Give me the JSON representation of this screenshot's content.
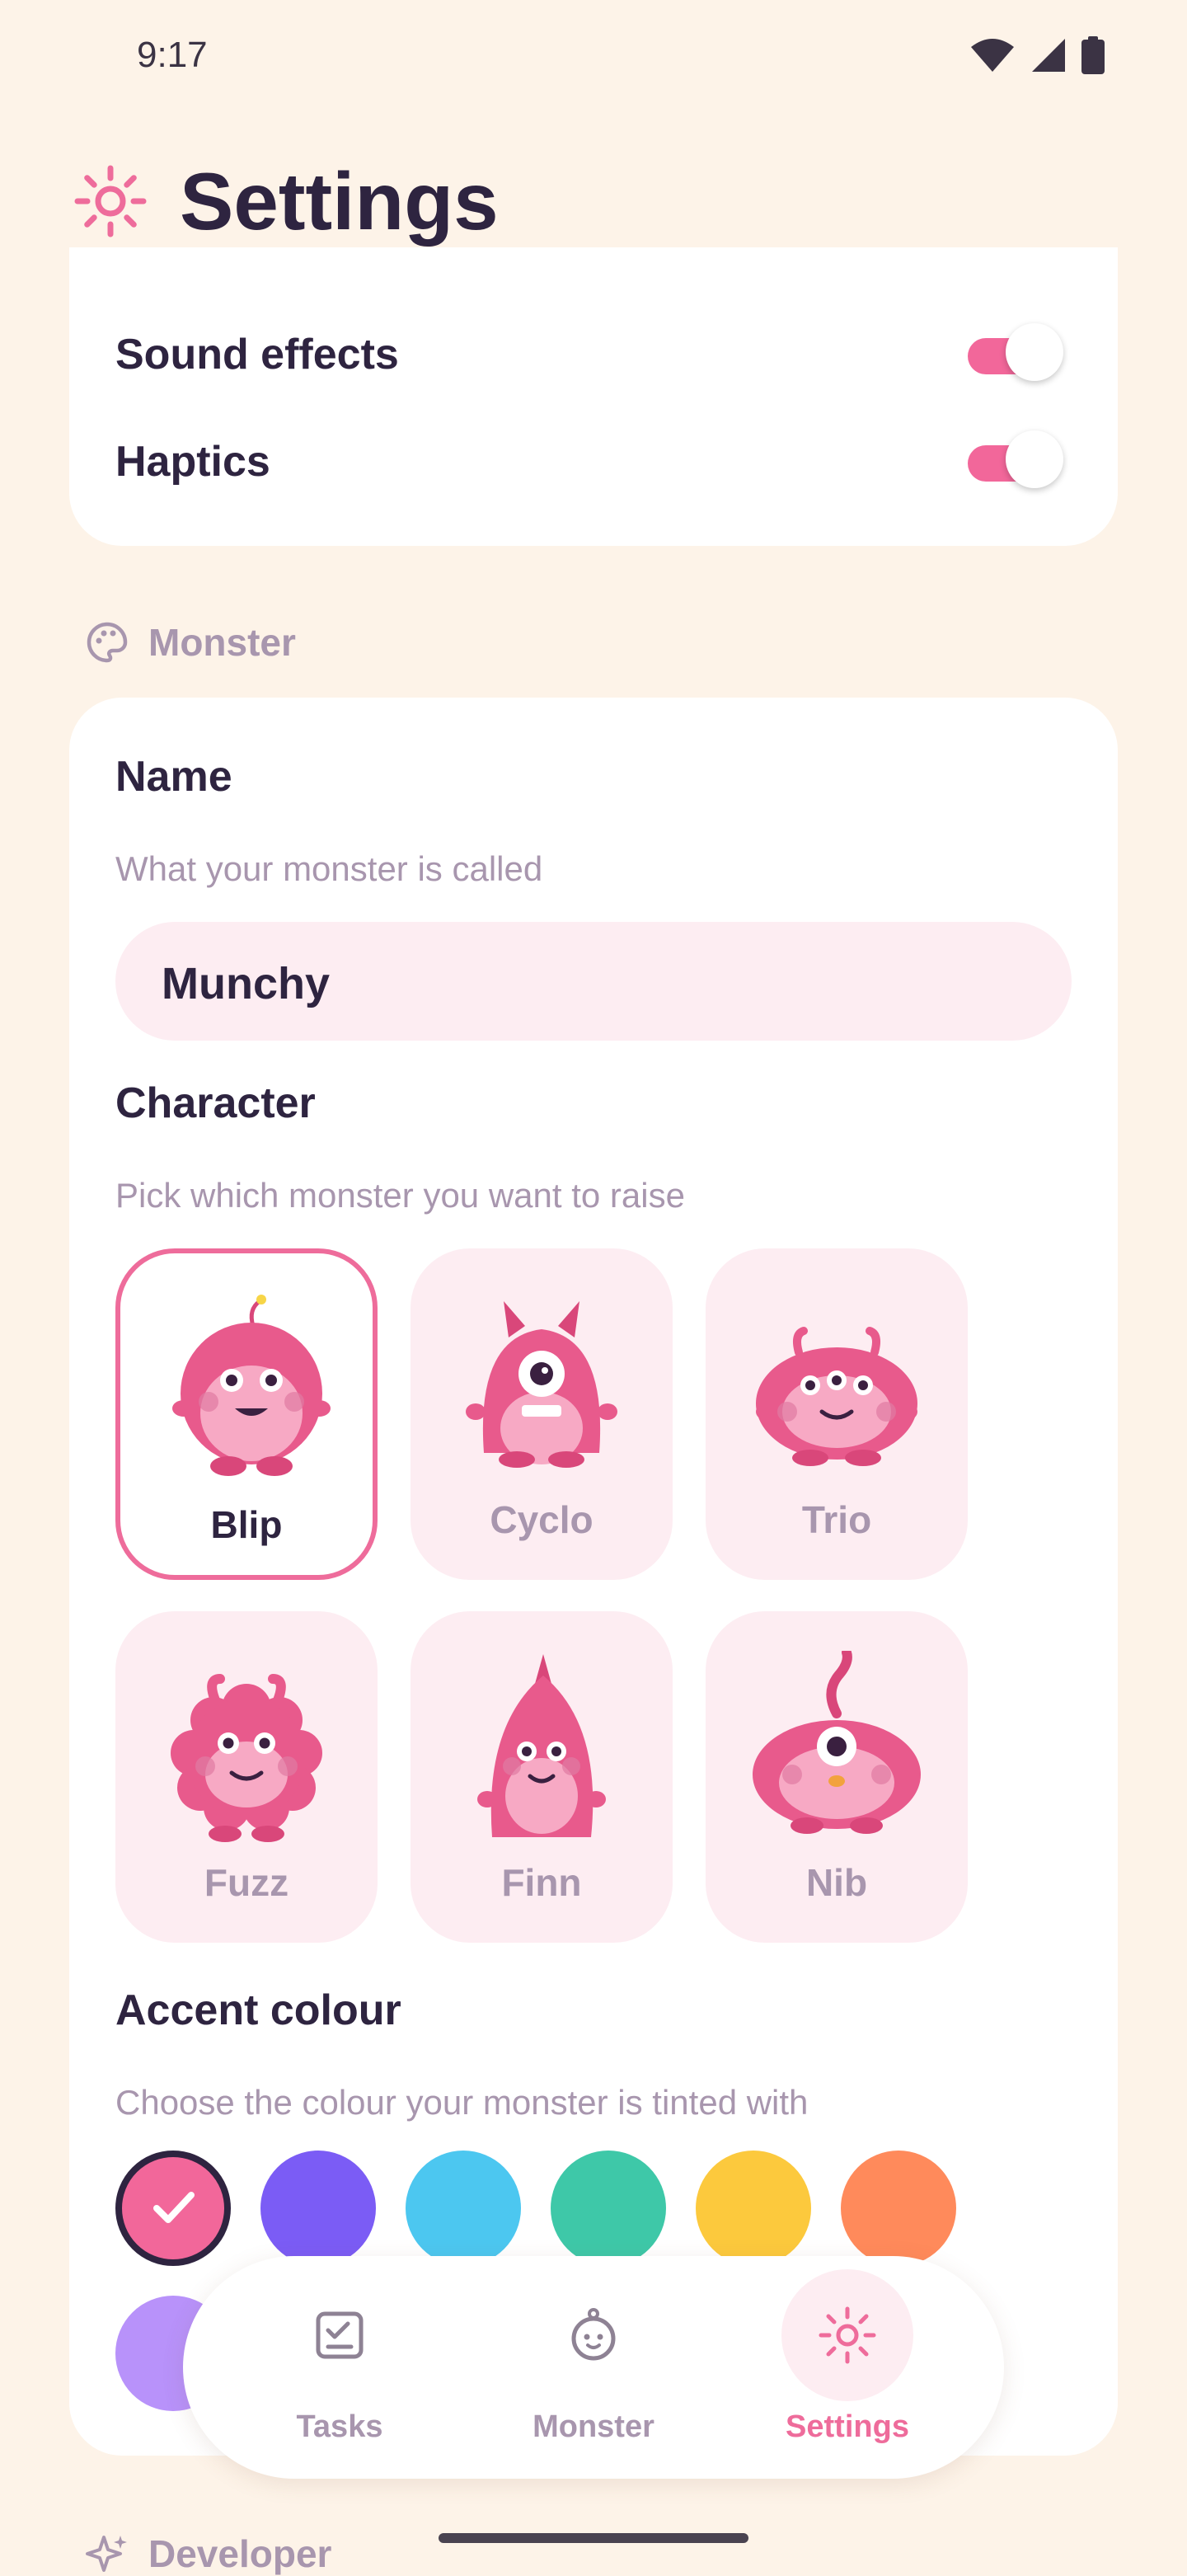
{
  "status_bar": {
    "time": "9:17"
  },
  "header": {
    "title": "Settings"
  },
  "toggles": [
    {
      "label": "Sound effects",
      "on": true
    },
    {
      "label": "Haptics",
      "on": true
    }
  ],
  "monster_section": {
    "heading": "Monster",
    "name_label": "Name",
    "name_help": "What your monster is called",
    "name_value": "Munchy",
    "character_label": "Character",
    "character_help": "Pick which monster you want to raise",
    "characters": [
      {
        "name": "Blip",
        "selected": true
      },
      {
        "name": "Cyclo",
        "selected": false
      },
      {
        "name": "Trio",
        "selected": false
      },
      {
        "name": "Fuzz",
        "selected": false
      },
      {
        "name": "Finn",
        "selected": false
      },
      {
        "name": "Nib",
        "selected": false
      }
    ],
    "accent_label": "Accent colour",
    "accent_help": "Choose the colour your monster is tinted with",
    "accent_colors": [
      "#F2679A",
      "#7B5CF5",
      "#4CC7F0",
      "#3EC8A8",
      "#FCC93D",
      "#FF8A5B",
      "#B892FA"
    ],
    "selected_accent": "#F2679A"
  },
  "developer_section": {
    "heading": "Developer"
  },
  "bottom_nav": {
    "items": [
      {
        "label": "Tasks",
        "icon": "tasks-icon",
        "active": false
      },
      {
        "label": "Monster",
        "icon": "monster-icon",
        "active": false
      },
      {
        "label": "Settings",
        "icon": "gear-icon",
        "active": true
      }
    ]
  },
  "colors": {
    "accent": "#EE6C9B",
    "background": "#FDF3E8",
    "muted_text": "#A896AE",
    "dark_text": "#2E2440"
  }
}
